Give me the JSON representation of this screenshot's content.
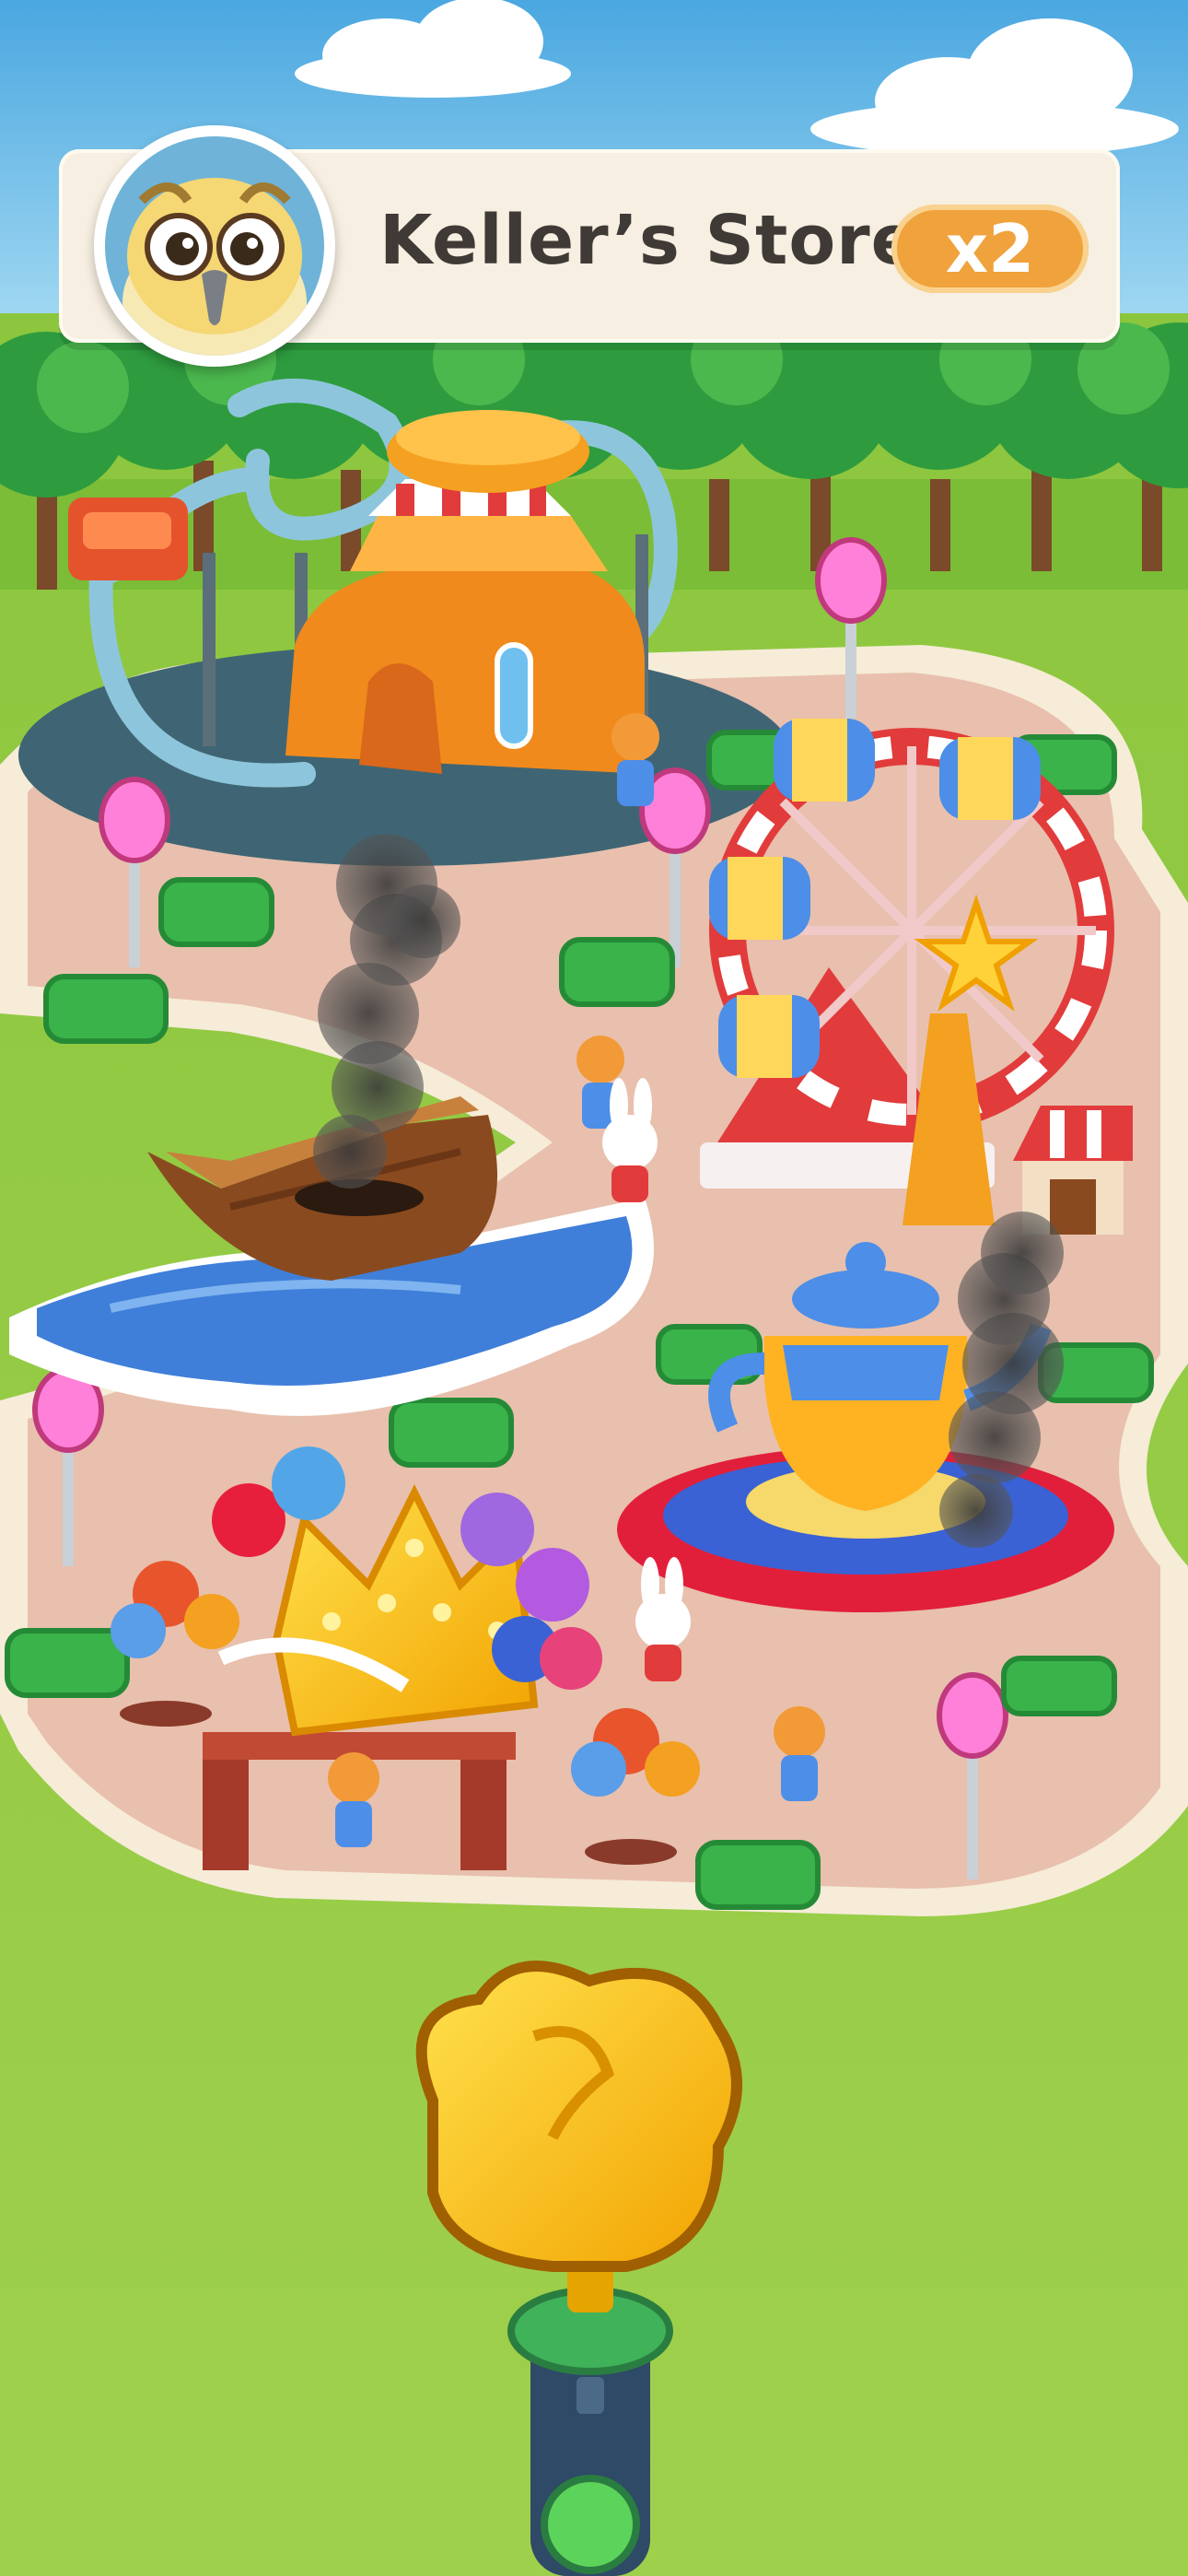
{
  "header": {
    "store_name": "Keller’s Store",
    "multiplier_label": "x2",
    "avatar_icon": "owl-avatar-icon"
  },
  "colors": {
    "sky": "#7cc3ea",
    "grass": "#9bce4a",
    "path": "#e9c4b2",
    "path_border": "#f6ecd8",
    "badge": "#f0a23c",
    "header_bg": "#f7efe1",
    "title_text": "#3f3a36"
  },
  "scene": {
    "attractions": [
      "roller-coaster",
      "ferris-wheel",
      "pirate-ship",
      "teapot-ride",
      "balloon-gate"
    ],
    "damaged_attractions": [
      "pirate-ship",
      "teapot-ride"
    ],
    "tool": "extinguisher-cannon"
  }
}
